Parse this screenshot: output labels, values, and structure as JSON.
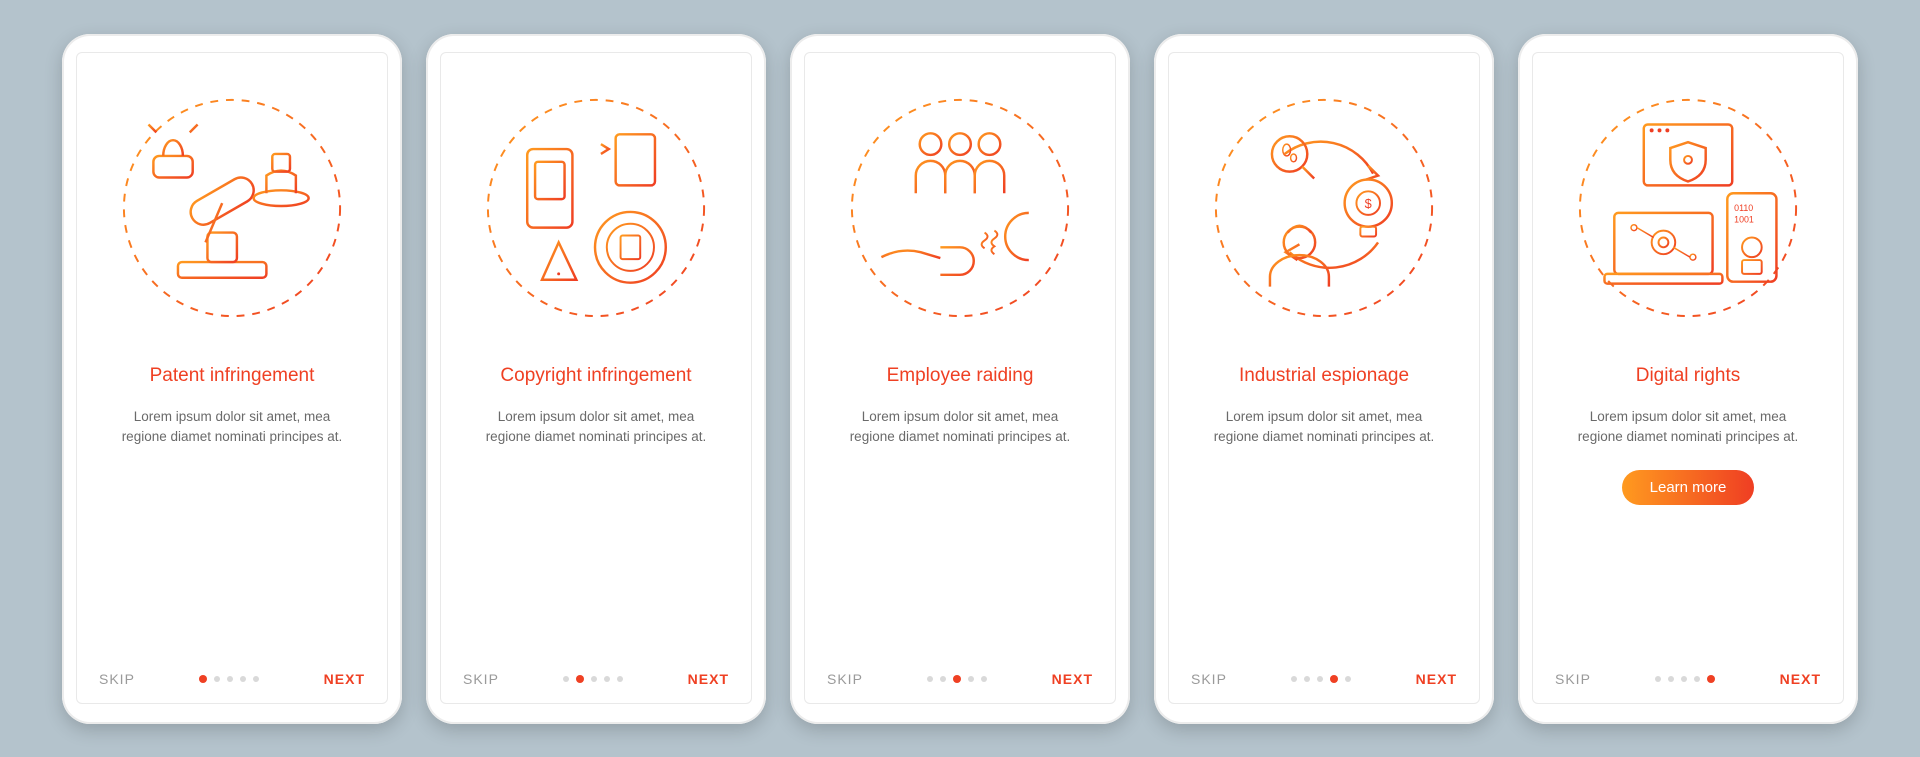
{
  "common": {
    "skip_label": "SKIP",
    "next_label": "NEXT",
    "body_text": "Lorem ipsum dolor sit amet, mea regione diamet nominati principes at.",
    "cta_label": "Learn more",
    "page_count": 5
  },
  "screens": [
    {
      "title": "Patent infringement",
      "active_index": 0,
      "illustration": "patent-gavel-stamp",
      "has_cta": false
    },
    {
      "title": "Copyright infringement",
      "active_index": 1,
      "illustration": "copyright-target-warning",
      "has_cta": false
    },
    {
      "title": "Employee raiding",
      "active_index": 2,
      "illustration": "employee-magnet",
      "has_cta": false
    },
    {
      "title": "Industrial espionage",
      "active_index": 3,
      "illustration": "spy-idea-money",
      "has_cta": false
    },
    {
      "title": "Digital rights",
      "active_index": 4,
      "illustration": "digital-shield-laptop",
      "has_cta": true
    }
  ],
  "colors": {
    "accent_gradient_start": "#ff9a1f",
    "accent_gradient_end": "#ef3e23",
    "title_color": "#ef4023",
    "body_color": "#6a6a6a",
    "skip_color": "#9a9a9a",
    "dot_inactive": "#d9d9d9",
    "page_background": "#b4c3cc"
  }
}
